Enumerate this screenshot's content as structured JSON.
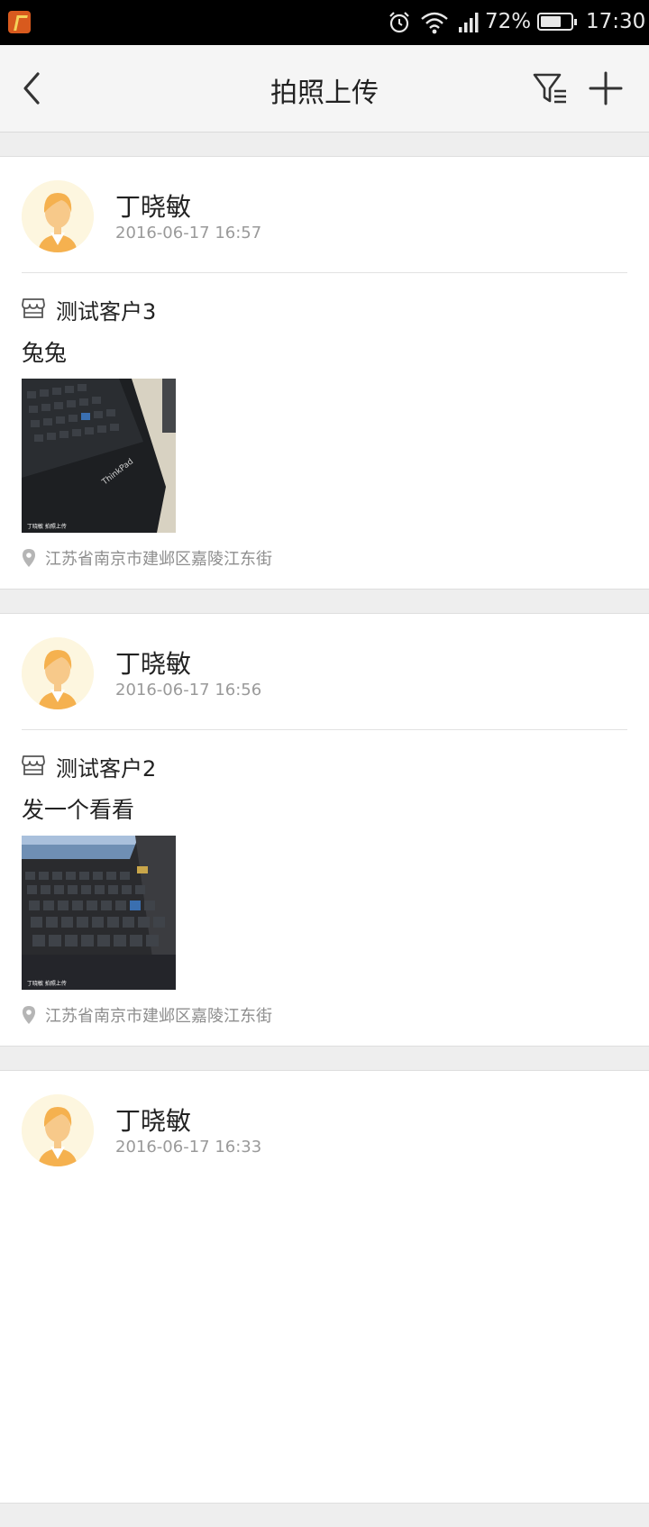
{
  "status_bar": {
    "battery_percent": "72%",
    "battery_level": 0.72,
    "time": "17:30",
    "icons": [
      "app-notification-icon",
      "alarm-icon",
      "wifi-icon",
      "signal-icon",
      "battery-icon"
    ]
  },
  "header": {
    "title": "拍照上传",
    "icons": [
      "back-arrow-icon",
      "filter-icon",
      "plus-icon"
    ]
  },
  "posts": [
    {
      "user": "丁晓敏",
      "time": "2016-06-17 16:57",
      "customer": "测试客户3",
      "text": "兔兔",
      "photo_caption": "丁晓敏 拍照上传",
      "photo_brand": "ThinkPad",
      "location": "江苏省南京市建邺区嘉陵江东街"
    },
    {
      "user": "丁晓敏",
      "time": "2016-06-17 16:56",
      "customer": "测试客户2",
      "text": "发一个看看",
      "photo_caption": "丁晓敏 拍照上传",
      "location": "江苏省南京市建邺区嘉陵江东街"
    },
    {
      "user": "丁晓敏",
      "time": "2016-06-17 16:33"
    }
  ],
  "colors": {
    "status_bar_bg": "#000000",
    "header_bg": "#f5f5f5",
    "page_bg": "#eeeeee",
    "avatar_skin": "#f7c98a",
    "avatar_hair": "#f5b14f"
  }
}
